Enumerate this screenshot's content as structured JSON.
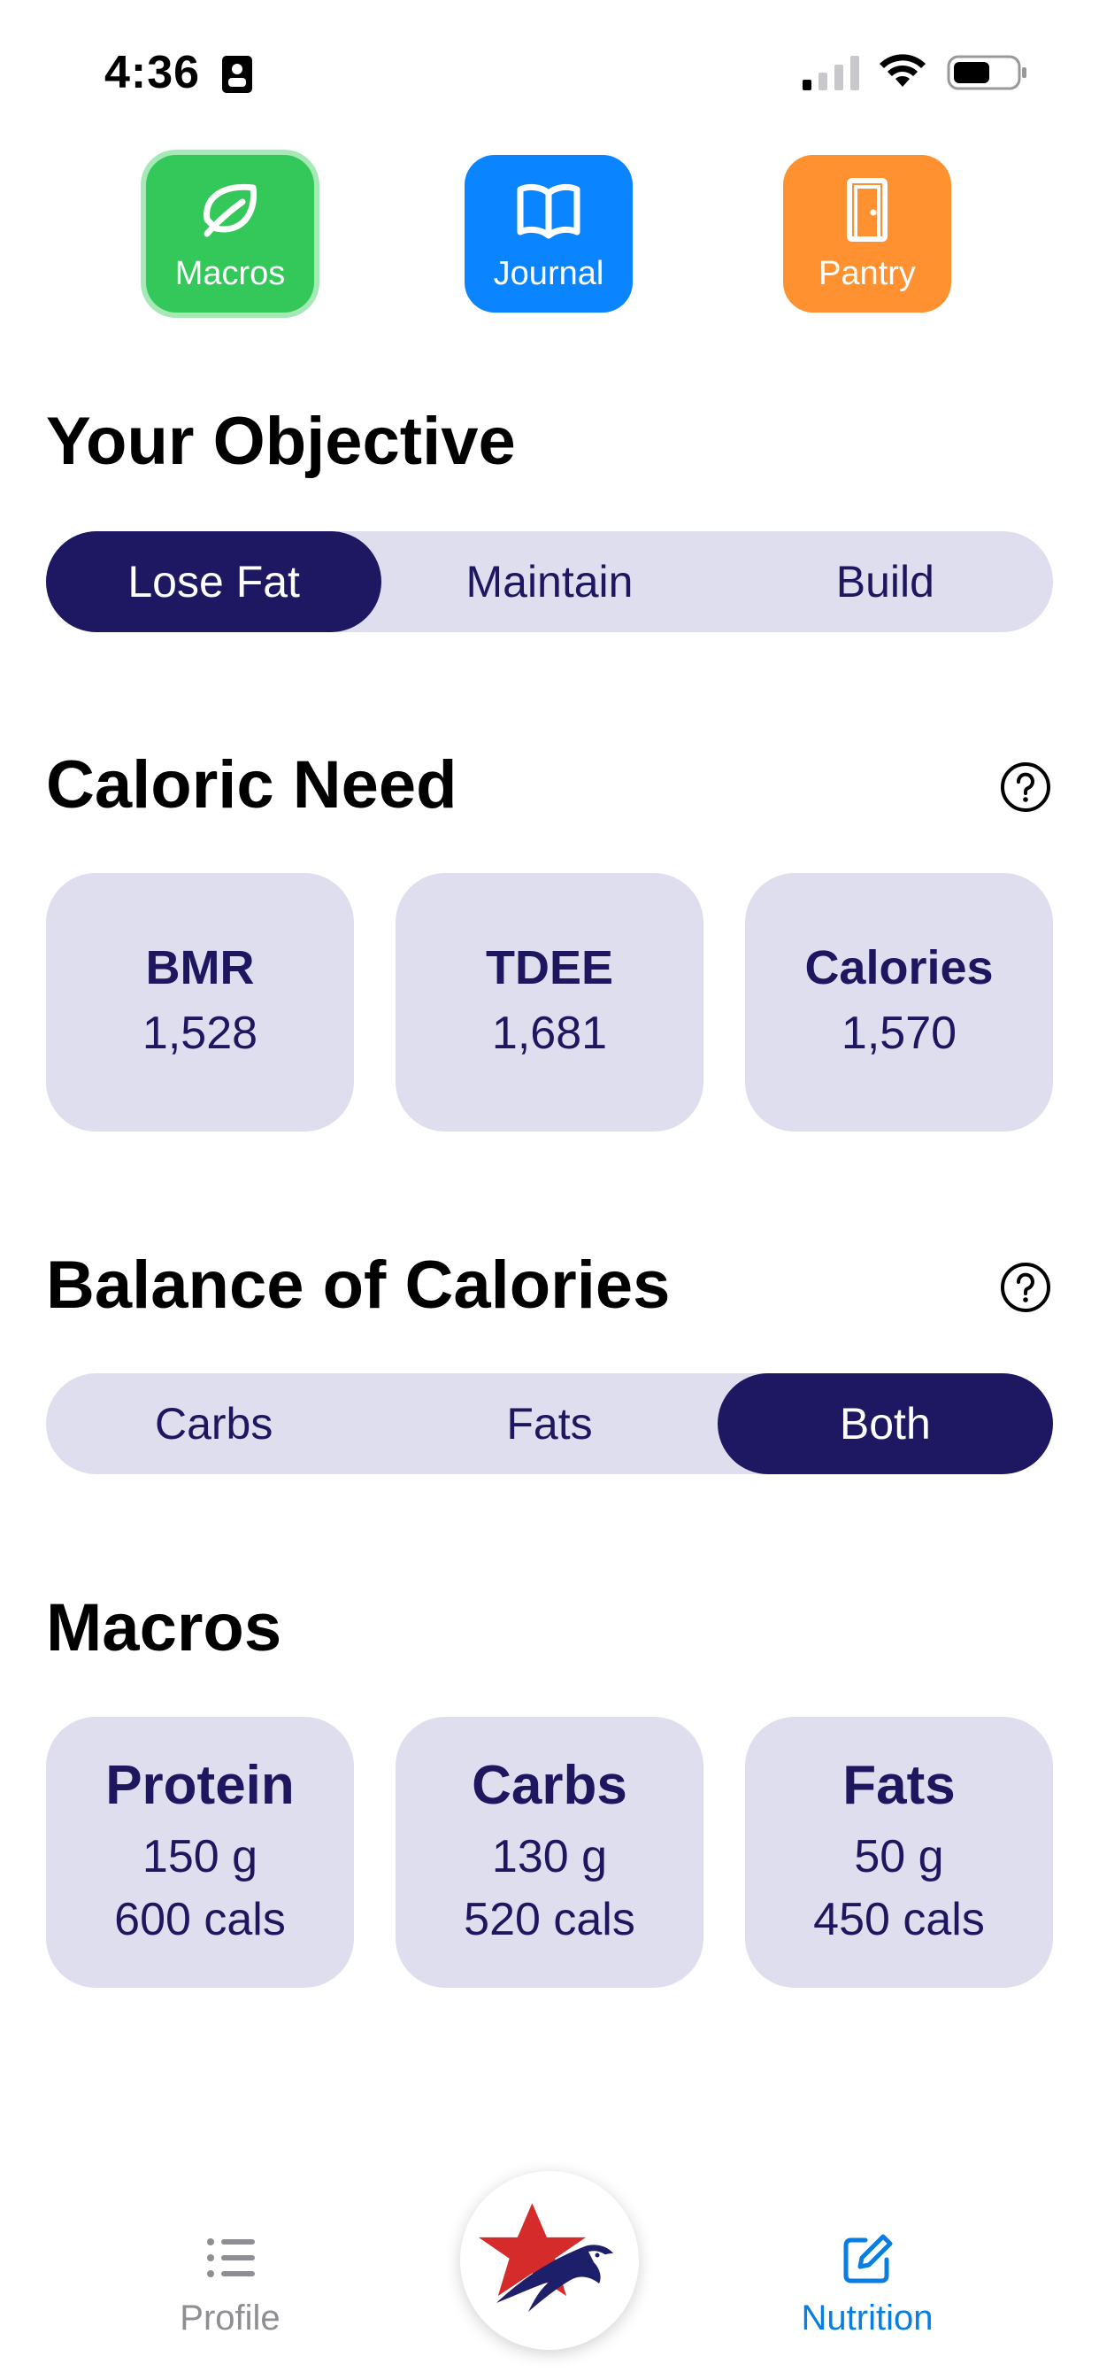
{
  "status_bar": {
    "time": "4:36"
  },
  "top_nav": [
    {
      "label": "Macros",
      "icon": "leaf-icon",
      "color": "#34c759",
      "selected": true
    },
    {
      "label": "Journal",
      "icon": "book-icon",
      "color": "#0a84ff",
      "selected": false
    },
    {
      "label": "Pantry",
      "icon": "door-icon",
      "color": "#ff9130",
      "selected": false
    }
  ],
  "objective": {
    "title": "Your Objective",
    "options": [
      "Lose Fat",
      "Maintain",
      "Build"
    ],
    "selected": "Lose Fat"
  },
  "caloric_need": {
    "title": "Caloric Need",
    "cards": [
      {
        "label": "BMR",
        "value": "1,528"
      },
      {
        "label": "TDEE",
        "value": "1,681"
      },
      {
        "label": "Calories",
        "value": "1,570"
      }
    ]
  },
  "balance": {
    "title": "Balance of Calories",
    "options": [
      "Carbs",
      "Fats",
      "Both"
    ],
    "selected": "Both"
  },
  "macros": {
    "title": "Macros",
    "cards": [
      {
        "label": "Protein",
        "grams": "150 g",
        "cals": "600 cals"
      },
      {
        "label": "Carbs",
        "grams": "130 g",
        "cals": "520 cals"
      },
      {
        "label": "Fats",
        "grams": "50 g",
        "cals": "450 cals"
      }
    ]
  },
  "tab_bar": {
    "profile_label": "Profile",
    "nutrition_label": "Nutrition",
    "selected": "Nutrition"
  },
  "colors": {
    "accent_navy": "#1e1761",
    "chip_bg": "#dfdeee",
    "nutrition_blue": "#0a7ee0"
  }
}
